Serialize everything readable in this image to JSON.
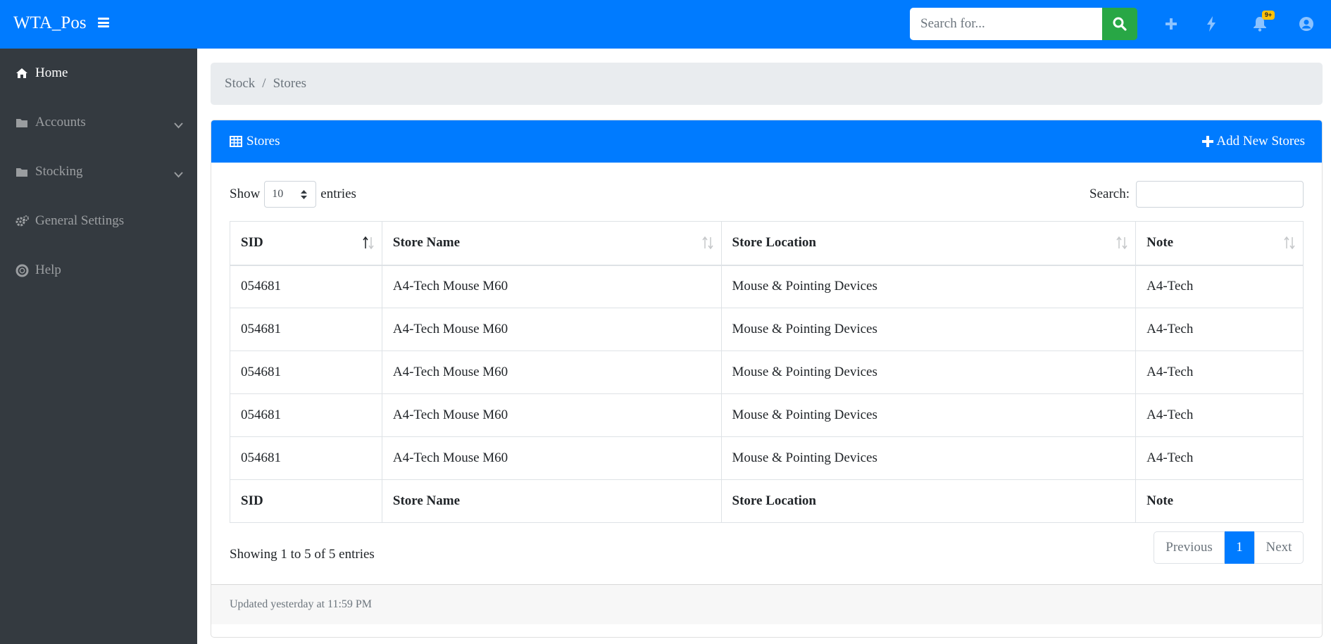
{
  "app": {
    "title": "WTA_Pos"
  },
  "topbar": {
    "search_placeholder": "Search for...",
    "badge_count": "9+",
    "colors": {
      "bar": "#007bff",
      "search_button": "#28a745",
      "badge": "#ffc107"
    },
    "icons": [
      "menu-icon",
      "search-icon",
      "plus-icon",
      "bolt-icon",
      "bell-icon",
      "user-circle-icon"
    ]
  },
  "sidebar": {
    "items": [
      {
        "label": "Home",
        "icon": "home-icon",
        "active": true
      },
      {
        "label": "Accounts",
        "icon": "folder-icon",
        "has_submenu": true
      },
      {
        "label": "Stocking",
        "icon": "folder-icon",
        "has_submenu": true
      },
      {
        "label": "General Settings",
        "icon": "gears-icon"
      },
      {
        "label": "Help",
        "icon": "life-ring-icon"
      }
    ]
  },
  "breadcrumb": {
    "items": [
      "Stock",
      "Stores"
    ],
    "separator": "/"
  },
  "card": {
    "title": "Stores",
    "add_button": "Add New Stores",
    "show_label": "Show",
    "entries_label": "entries",
    "page_length": "10",
    "search_label": "Search:",
    "table": {
      "columns": [
        "SID",
        "Store Name",
        "Store Location",
        "Note"
      ],
      "rows": [
        [
          "054681",
          "A4-Tech Mouse M60",
          "Mouse & Pointing Devices",
          "A4-Tech"
        ],
        [
          "054681",
          "A4-Tech Mouse M60",
          "Mouse & Pointing Devices",
          "A4-Tech"
        ],
        [
          "054681",
          "A4-Tech Mouse M60",
          "Mouse & Pointing Devices",
          "A4-Tech"
        ],
        [
          "054681",
          "A4-Tech Mouse M60",
          "Mouse & Pointing Devices",
          "A4-Tech"
        ],
        [
          "054681",
          "A4-Tech Mouse M60",
          "Mouse & Pointing Devices",
          "A4-Tech"
        ]
      ]
    },
    "info": "Showing 1 to 5 of 5 entries",
    "pagination": {
      "previous": "Previous",
      "current": "1",
      "next": "Next"
    },
    "footer": "Updated yesterday at 11:59 PM"
  }
}
